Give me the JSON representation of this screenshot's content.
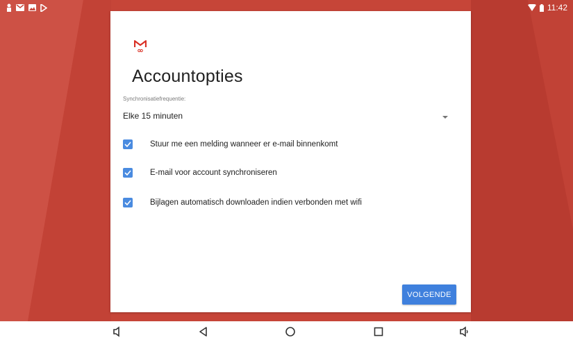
{
  "status_bar": {
    "time": "11:42",
    "left_icons": [
      "person-icon",
      "gmail-notification-icon",
      "image-notification-icon",
      "play-store-icon"
    ],
    "right_icons": [
      "wifi-icon",
      "battery-icon"
    ]
  },
  "card": {
    "title": "Accountopties",
    "sync_label": "Synchronisatiefrequentie:",
    "sync_value": "Elke 15 minuten",
    "options": [
      {
        "label": "Stuur me een melding wanneer er e-mail binnenkomt",
        "checked": true
      },
      {
        "label": "E-mail voor account synchroniseren",
        "checked": true
      },
      {
        "label": "Bijlagen automatisch downloaden indien verbonden met wifi",
        "checked": true
      }
    ],
    "next_label": "VOLGENDE"
  },
  "colors": {
    "background": "#c8473b",
    "accent": "#3f80dd",
    "checkbox": "#4a8be0"
  },
  "nav_bar": {
    "buttons": [
      "volume-down-icon",
      "back-icon",
      "home-icon",
      "recents-icon",
      "volume-up-icon"
    ]
  }
}
